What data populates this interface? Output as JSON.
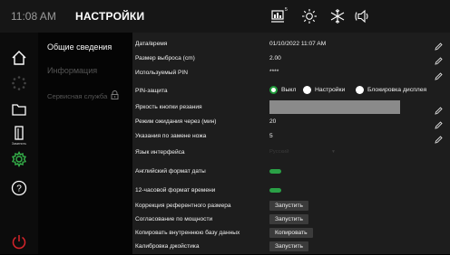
{
  "topbar": {
    "time": "11:08 AM",
    "title": "НАСТРОЙКИ",
    "icons": [
      "screen-icon",
      "brightness-icon",
      "snowflake-icon",
      "speaker-icon"
    ],
    "screen_badge": "5"
  },
  "nav": {
    "icons": [
      "home-icon",
      "loading-icon",
      "folder-icon",
      "knife-icon",
      "gear-icon",
      "help-icon",
      "power-icon"
    ],
    "knife_label": "Заменить",
    "active_color": "#35b24a"
  },
  "menu": {
    "items": [
      {
        "label": "Общие сведения"
      },
      {
        "label": "Информация"
      },
      {
        "label": "Сервисная служба"
      }
    ]
  },
  "settings": {
    "datetime": {
      "label": "Дата/время",
      "value": "01/10/2022 11:07 AM"
    },
    "offset": {
      "label": "Размер выброса (cm)",
      "value": "2.00"
    },
    "pin_used": {
      "label": "Используемый PIN",
      "value": "****"
    },
    "pin_protect": {
      "label": "PIN-защита",
      "options": [
        "Выкл",
        "Настройки",
        "Блокировка дисплея"
      ],
      "selected": "Выкл"
    },
    "cut_brightness": {
      "label": "Яркость кнопки резания",
      "fraction": 0.0
    },
    "standby": {
      "label": "Режим ожидания через (мин)",
      "value": "20"
    },
    "knife_hint": {
      "label": "Указания по замене ножа",
      "value": "5"
    },
    "language": {
      "label": "Язык интерфейса",
      "value": "Русский"
    },
    "en_date": {
      "label": "Английский формат даты",
      "on": true
    },
    "clock12": {
      "label": "12-часовой формат времени",
      "on": true
    },
    "ref_correction": {
      "label": "Коррекция референтного размера",
      "button": "Запустить"
    },
    "power_match": {
      "label": "Согласование по мощности",
      "button": "Запустить"
    },
    "copy_db": {
      "label": "Копировать внутреннюю базу данных",
      "button": "Копировать"
    },
    "joystick": {
      "label": "Калибровка джойстика",
      "button": "Запустить"
    }
  },
  "colors": {
    "accent": "#2aa046",
    "power": "#d8242b"
  }
}
